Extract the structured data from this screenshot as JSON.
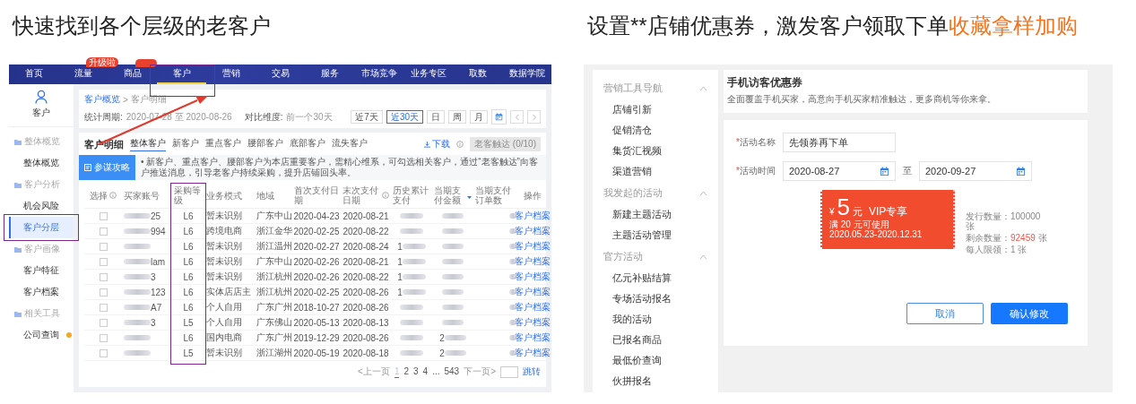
{
  "left_panel": {
    "heading": "快速找到各个层级的老客户",
    "nav": [
      {
        "label": "首页",
        "selected": false,
        "highlighted": false,
        "badged": false
      },
      {
        "label": "流量",
        "selected": false,
        "highlighted": false,
        "badged": true,
        "badge_text": "升级啦"
      },
      {
        "label": "商品",
        "selected": false,
        "highlighted": false,
        "badged": true
      },
      {
        "label": "客户",
        "selected": true,
        "highlighted": true,
        "badged": false
      },
      {
        "label": "营销",
        "selected": false,
        "highlighted": false,
        "badged": false
      },
      {
        "label": "交易",
        "selected": false,
        "highlighted": false,
        "badged": false
      },
      {
        "label": "服务",
        "selected": false,
        "highlighted": false,
        "badged": false
      },
      {
        "label": "市场竞争",
        "selected": false,
        "highlighted": false,
        "badged": false
      },
      {
        "label": "业务专区",
        "selected": false,
        "highlighted": false,
        "badged": false
      },
      {
        "label": "取数",
        "selected": false,
        "highlighted": false,
        "badged": false
      },
      {
        "label": "数据学院",
        "selected": false,
        "highlighted": false,
        "badged": false
      }
    ],
    "sidebar": {
      "title": "客户",
      "groups": [
        {
          "label": "整体概览",
          "items": [
            {
              "label": "整体概览",
              "selected": false,
              "highlighted": false,
              "notice": false
            }
          ]
        },
        {
          "label": "客户分析",
          "items": [
            {
              "label": "机会风险",
              "selected": false,
              "highlighted": false,
              "notice": false
            },
            {
              "label": "客户分层",
              "selected": true,
              "highlighted": true,
              "notice": false
            }
          ]
        },
        {
          "label": "客户画像",
          "items": [
            {
              "label": "客户特征",
              "selected": false,
              "highlighted": false,
              "notice": false
            },
            {
              "label": "客户档案",
              "selected": false,
              "highlighted": false,
              "notice": false
            }
          ]
        },
        {
          "label": "相关工具",
          "items": [
            {
              "label": "公司查询",
              "selected": false,
              "highlighted": false,
              "notice": true
            }
          ]
        }
      ]
    },
    "breadcrumb": {
      "parent": "客户概览",
      "separator": ">",
      "current": "客户明细"
    },
    "period": {
      "label": "统计周期:",
      "range": "2020-07-28 至 2020-08-26",
      "compare_label": "对比维度:",
      "compare": "前一个30天"
    },
    "ranges": [
      {
        "label": "近7天",
        "selected": false
      },
      {
        "label": "近30天",
        "selected": true
      },
      {
        "label": "日",
        "selected": false
      },
      {
        "label": "周",
        "selected": false
      },
      {
        "label": "月",
        "selected": false
      }
    ],
    "detail": {
      "title": "客户明细",
      "tabs": [
        {
          "label": "整体客户",
          "selected": true
        },
        {
          "label": "新客户",
          "selected": false
        },
        {
          "label": "重点客户",
          "selected": false
        },
        {
          "label": "腰部客户",
          "selected": false
        },
        {
          "label": "底部客户",
          "selected": false
        },
        {
          "label": "流失客户",
          "selected": false
        }
      ],
      "download": "下载",
      "action": {
        "label": "老客触达 (0/10)",
        "disabled": true
      },
      "guide": "参谋攻略",
      "note": "• 新客户、重点客户、腰部客户为本店重要客户，需精心维系，可勾选相关客户，通过“老客触达”向客户推送消息，引导老客户持续采购，提升店铺回头率。"
    },
    "columns": [
      {
        "label": "选择",
        "info": true,
        "sorted": false,
        "highlighted": false
      },
      {
        "label": "买家账号",
        "info": false,
        "sorted": false,
        "highlighted": false
      },
      {
        "label": "采购等级",
        "info": false,
        "sorted": false,
        "highlighted": true
      },
      {
        "label": "业务模式",
        "info": false,
        "sorted": false,
        "highlighted": false
      },
      {
        "label": "地域",
        "info": false,
        "sorted": false,
        "highlighted": false
      },
      {
        "label": "首次支付日期",
        "info": false,
        "sorted": false,
        "highlighted": false
      },
      {
        "label": "末次支付日期",
        "info": true,
        "sorted": false,
        "highlighted": false
      },
      {
        "label": "历史累计支付",
        "info": false,
        "sorted": false,
        "highlighted": false
      },
      {
        "label": "当期支付金额",
        "info": false,
        "sorted": true,
        "highlighted": false
      },
      {
        "label": "当期支付订单数",
        "info": false,
        "sorted": false,
        "highlighted": false
      },
      {
        "label": "操作",
        "info": false,
        "sorted": false,
        "highlighted": false
      }
    ],
    "rows": [
      {
        "checked": false,
        "account": "25",
        "level": "L6",
        "mode": "暂未识别",
        "region": "广东中山",
        "first": "2020-04-23",
        "last": "2020-08-21",
        "action": "客户档案"
      },
      {
        "checked": false,
        "account": "994",
        "level": "L6",
        "mode": "跨境电商",
        "region": "浙江金华",
        "first": "2020-02-25",
        "last": "2020-08-22",
        "action": "客户档案"
      },
      {
        "checked": false,
        "level": "L6",
        "mode": "暂未识别",
        "region": "浙江温州",
        "first": "2020-02-27",
        "last": "2020-08-24",
        "history_prefix": "1",
        "action": "客户档案"
      },
      {
        "checked": false,
        "account": "lam",
        "level": "L6",
        "mode": "暂未识别",
        "region": "广东中山",
        "first": "2020-02-26",
        "last": "2020-08-21",
        "history_prefix": "1",
        "action": "客户档案"
      },
      {
        "checked": false,
        "account": "3",
        "level": "L6",
        "mode": "暂未识别",
        "region": "浙江杭州",
        "first": "2020-02-26",
        "last": "2020-08-22",
        "history_prefix": "1",
        "action": "客户档案"
      },
      {
        "checked": false,
        "account": "123",
        "level": "L6",
        "mode": "实体店店主",
        "region": "浙江杭州",
        "first": "2020-02-25",
        "last": "2020-08-26",
        "history_prefix": "1",
        "action": "客户档案"
      },
      {
        "checked": false,
        "account": "A7",
        "level": "L6",
        "mode": "个人自用",
        "region": "广东广州",
        "first": "2018-10-27",
        "last": "2020-08-26",
        "action": "客户档案"
      },
      {
        "checked": false,
        "account": "3",
        "level": "L5",
        "mode": "个人自用",
        "region": "广东佛山",
        "first": "2020-05-13",
        "last": "2020-08-13",
        "action": "客户档案"
      },
      {
        "checked": false,
        "level": "L6",
        "mode": "国内电商",
        "region": "广东广州",
        "first": "2019-12-29",
        "last": "2020-08-26",
        "amount_prefix": "2",
        "action": "客户档案"
      },
      {
        "checked": false,
        "level": "L5",
        "mode": "暂未识别",
        "region": "浙江湖州",
        "first": "2020-05-19",
        "last": "2020-08-18",
        "amount_prefix": "2",
        "action": "客户档案"
      }
    ],
    "pagination": {
      "prev": "<上一页",
      "pages": [
        {
          "label": "1",
          "selected": true
        },
        {
          "label": "2",
          "selected": false
        },
        {
          "label": "3",
          "selected": false
        },
        {
          "label": "4",
          "selected": false
        },
        {
          "label": "...",
          "selected": false
        },
        {
          "label": "543",
          "selected": false
        }
      ],
      "next": "下一页>",
      "jump": "跳转"
    }
  },
  "right_panel": {
    "heading": "设置**店铺优惠券，激发客户领取下单",
    "heading_highlight": "收藏拿样加购",
    "sidebar": [
      {
        "label": "营销工具导航",
        "expanded": true,
        "items": [
          "店铺引新",
          "促销清仓",
          "集货汇视频",
          "渠道营销"
        ]
      },
      {
        "label": "我发起的活动",
        "expanded": true,
        "items": [
          "新建主题活动",
          "主题活动管理"
        ]
      },
      {
        "label": "官方活动",
        "expanded": true,
        "items": [
          "亿元补贴结算",
          "专场活动报名",
          "我的活动",
          "已报名商品",
          "最低价查询",
          "伙拼报名"
        ]
      }
    ],
    "title": "手机访客优惠券",
    "subtitle": "全面覆盖手机买家，高意向手机买家精准触达，更多商机等你来拿。",
    "name_field": {
      "mark": "*",
      "label": "活动名称",
      "value": "先领券再下单"
    },
    "time_field": {
      "mark": "*",
      "label": "活动时间",
      "start": "2020-08-27",
      "separator": "至",
      "end": "2020-09-27"
    },
    "coupon": {
      "currency": "¥",
      "amount": "5",
      "unit": "元",
      "tag": "VIP专享",
      "condition": "满 20 元可使用",
      "validity": "2020.05.23-2020.12.31"
    },
    "stats": [
      {
        "label": "发行数量：",
        "value": "100000",
        "unit": "张",
        "emphasis": false
      },
      {
        "label": "剩余数量：",
        "value": "92459",
        "unit": "张",
        "emphasis": true
      },
      {
        "label": "每人限领：",
        "value": "1",
        "unit": "张",
        "emphasis": false
      }
    ],
    "buttons": [
      {
        "label": "取消",
        "kind": "secondary"
      },
      {
        "label": "确认修改",
        "kind": "primary"
      }
    ]
  }
}
